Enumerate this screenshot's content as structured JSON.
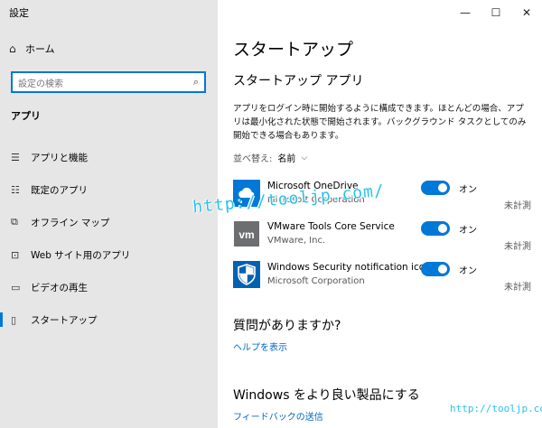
{
  "window": {
    "title": "設定",
    "controls": {
      "minimize": "—",
      "maximize": "☐",
      "close": "✕"
    }
  },
  "sidebar": {
    "home_label": "ホーム",
    "search_placeholder": "設定の検索",
    "section_title": "アプリ",
    "items": [
      {
        "label": "アプリと機能",
        "icon": "apps-features-icon",
        "glyph": "☰"
      },
      {
        "label": "既定のアプリ",
        "icon": "default-apps-icon",
        "glyph": "☷"
      },
      {
        "label": "オフライン マップ",
        "icon": "offline-maps-icon",
        "glyph": "⧉"
      },
      {
        "label": "Web サイト用のアプリ",
        "icon": "apps-for-websites-icon",
        "glyph": "⊡"
      },
      {
        "label": "ビデオの再生",
        "icon": "video-playback-icon",
        "glyph": "▭"
      },
      {
        "label": "スタートアップ",
        "icon": "startup-icon",
        "glyph": "▯",
        "active": true
      }
    ]
  },
  "main": {
    "title": "スタートアップ",
    "subtitle": "スタートアップ アプリ",
    "description": "アプリをログイン時に開始するように構成できます。ほとんどの場合、アプリは最小化された状態で開始されます。バックグラウンド タスクとしてのみ開始できる場合もあります。",
    "sort": {
      "label": "並べ替え:",
      "value": "名前"
    },
    "apps": [
      {
        "name": "Microsoft OneDrive",
        "publisher": "Microsoft Corporation",
        "state": "オン",
        "on": true,
        "impact": "未計測",
        "icon": "onedrive-icon"
      },
      {
        "name": "VMware Tools Core Service",
        "publisher": "VMware, Inc.",
        "state": "オン",
        "on": true,
        "impact": "未計測",
        "icon": "vmware-icon"
      },
      {
        "name": "Windows Security notification icon",
        "publisher": "Microsoft Corporation",
        "state": "オン",
        "on": true,
        "impact": "未計測",
        "icon": "windows-security-icon"
      }
    ],
    "question": {
      "title": "質問がありますか?",
      "link": "ヘルプを表示"
    },
    "improve": {
      "title": "Windows をより良い製品にする",
      "link": "フィードバックの送信"
    }
  },
  "watermarks": [
    "http://tooljp.com/",
    "http://tooljp.com"
  ],
  "colors": {
    "accent": "#0078d7",
    "sidebar_bg": "#e6e6e6",
    "link": "#0067c0"
  }
}
